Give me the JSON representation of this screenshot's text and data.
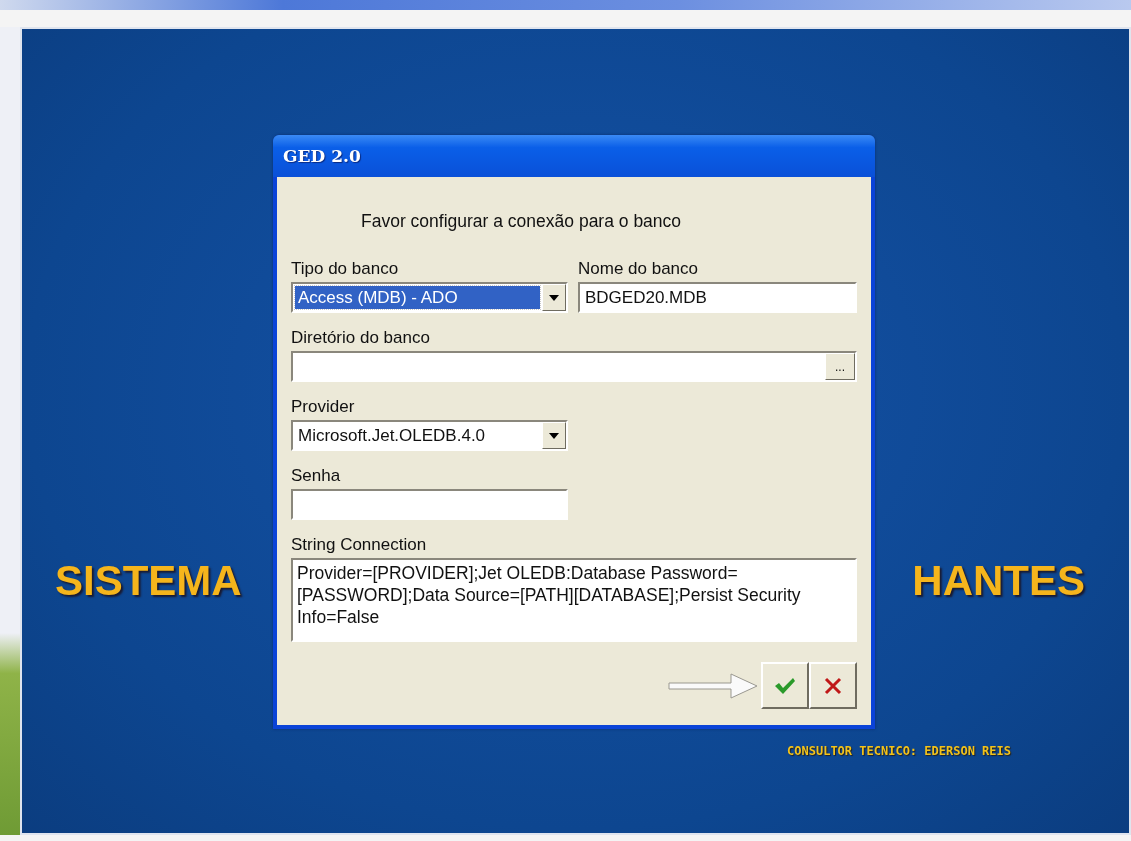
{
  "window": {
    "banner": [
      "SISTEMA",
      "HANTES"
    ],
    "credit": "CONSULTOR TECNICO: EDERSON REIS"
  },
  "dialog": {
    "title": "GED 2.0",
    "message": "Favor configurar a conexão para o banco",
    "rows": [
      [
        {
          "kind": "combo",
          "label": "Tipo do banco",
          "value": "Access (MDB) - ADO",
          "highlighted": true
        },
        {
          "kind": "text",
          "label": "Nome do banco",
          "value": "BDGED20.MDB"
        }
      ],
      [
        {
          "kind": "browse",
          "label": "Diretório do banco",
          "button": "..."
        }
      ],
      [
        {
          "kind": "combo",
          "label": "Provider",
          "value": "Microsoft.Jet.OLEDB.4.0",
          "highlighted": false
        }
      ],
      [
        {
          "kind": "password",
          "label": "Senha"
        }
      ],
      [
        {
          "kind": "memo",
          "label": "String Connection",
          "value": "Provider=[PROVIDER];Jet OLEDB:Database Password=[PASSWORD];Data Source=[PATH][DATABASE];Persist Security Info=False"
        }
      ]
    ],
    "buttons": [
      {
        "kind": "ok"
      },
      {
        "kind": "cancel"
      }
    ]
  }
}
